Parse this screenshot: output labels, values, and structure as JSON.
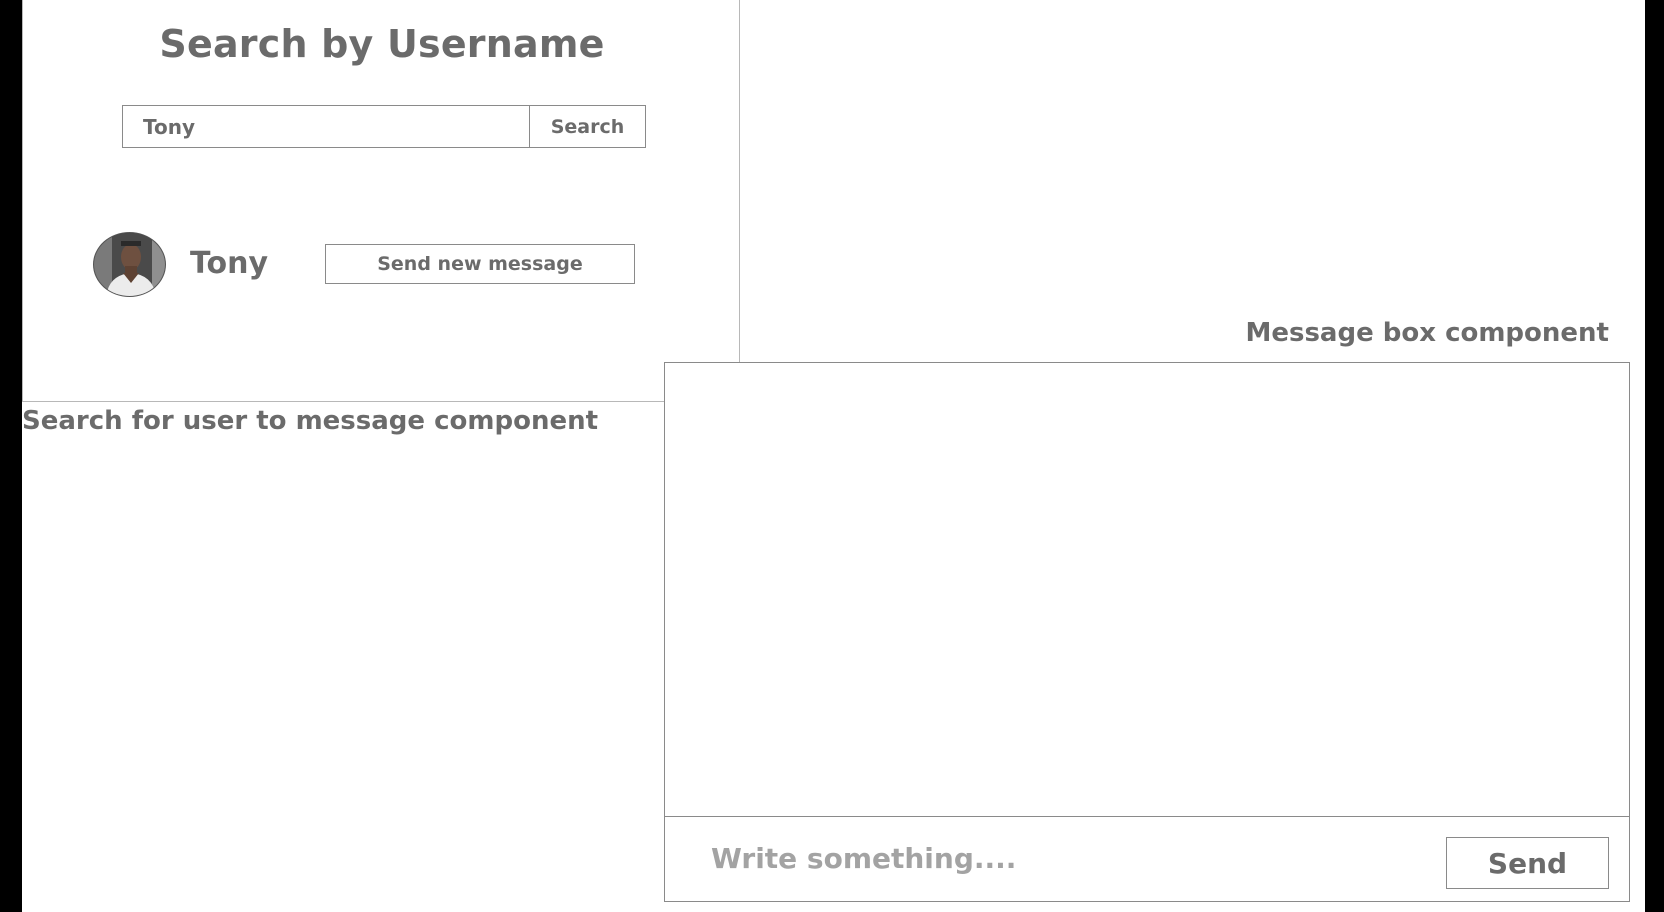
{
  "search_panel": {
    "title": "Search by Username",
    "input_value": "Tony",
    "search_label": "Search",
    "result": {
      "name": "Tony",
      "avatar_icon": "user-avatar-photo",
      "action_label": "Send new message"
    },
    "caption": "Search for user to message component"
  },
  "message_box": {
    "caption": "Message box component",
    "compose_placeholder": "Write something....",
    "send_label": "Send"
  }
}
